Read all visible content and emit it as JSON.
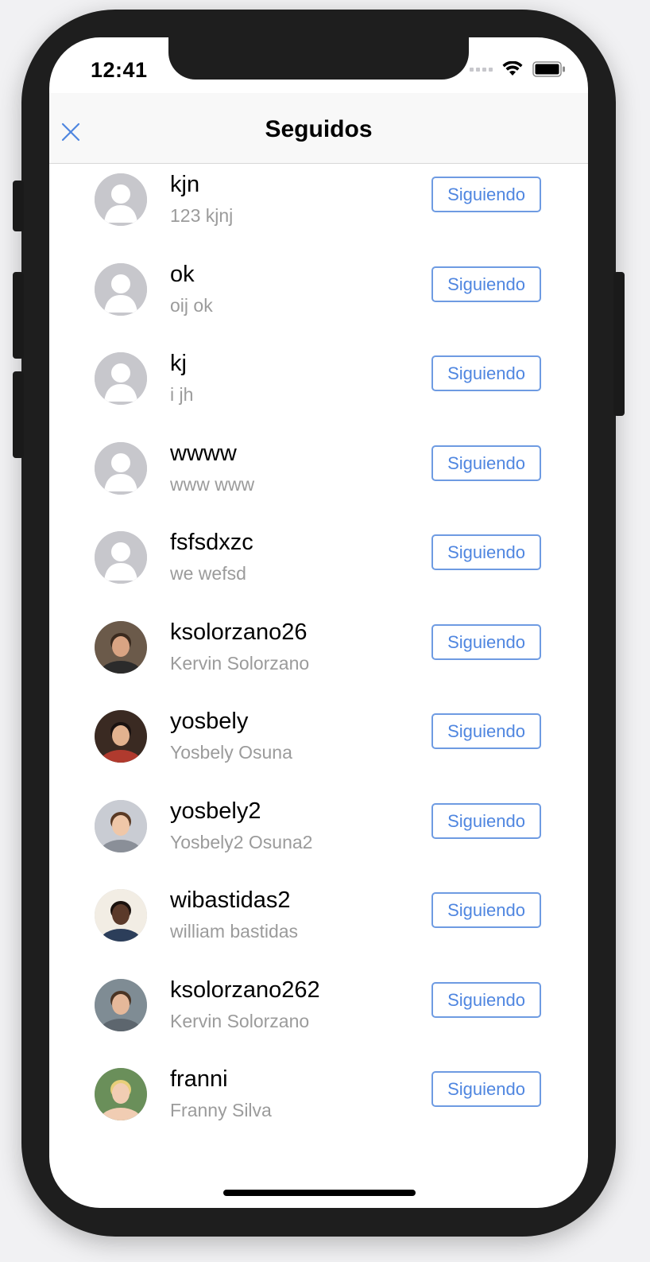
{
  "status_bar": {
    "time": "12:41"
  },
  "navbar": {
    "title": "Seguidos",
    "close_icon": "close-icon"
  },
  "colors": {
    "accent": "#4f86e0",
    "secondary_text": "#9b9b9b",
    "placeholder_avatar": "#c7c7cc"
  },
  "follow_button_label": "Siguiendo",
  "rows": [
    {
      "username": "kjn",
      "fullname": "123 kjnj",
      "avatar": "placeholder"
    },
    {
      "username": "ok",
      "fullname": "oij ok",
      "avatar": "placeholder"
    },
    {
      "username": "kj",
      "fullname": "i jh",
      "avatar": "placeholder"
    },
    {
      "username": "wwww",
      "fullname": "www www",
      "avatar": "placeholder"
    },
    {
      "username": "fsfsdxzc",
      "fullname": "we wefsd",
      "avatar": "placeholder"
    },
    {
      "username": "ksolorzano26",
      "fullname": "Kervin Solorzano",
      "avatar": "photo"
    },
    {
      "username": "yosbely",
      "fullname": "Yosbely Osuna",
      "avatar": "photo"
    },
    {
      "username": "yosbely2",
      "fullname": "Yosbely2 Osuna2",
      "avatar": "photo"
    },
    {
      "username": "wibastidas2",
      "fullname": "william bastidas",
      "avatar": "photo"
    },
    {
      "username": "ksolorzano262",
      "fullname": "Kervin Solorzano",
      "avatar": "photo"
    },
    {
      "username": "franni",
      "fullname": "Franny Silva",
      "avatar": "photo"
    }
  ]
}
